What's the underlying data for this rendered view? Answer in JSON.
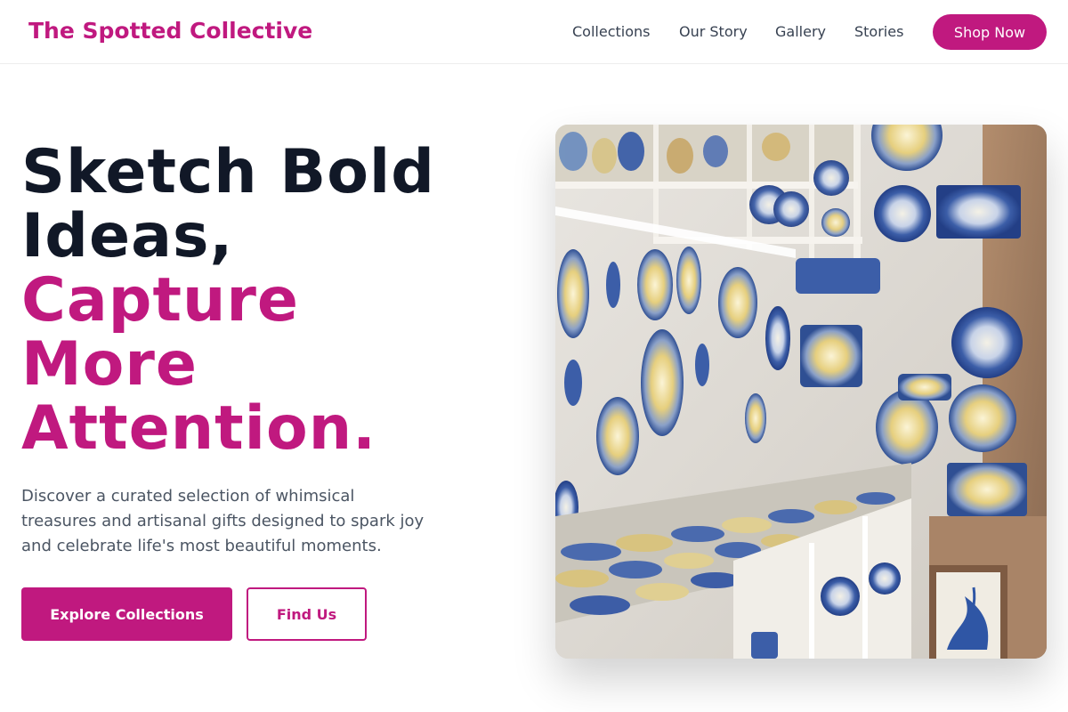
{
  "header": {
    "brand": "The Spotted Collective",
    "nav": [
      "Collections",
      "Our Story",
      "Gallery",
      "Stories"
    ],
    "cta": "Shop Now"
  },
  "hero": {
    "title_dark": [
      "Sketch Bold",
      "Ideas,"
    ],
    "title_accent": [
      "Capture",
      "More",
      "Attention."
    ],
    "description": "Discover a curated selection of whimsical treasures and artisanal gifts designed to spark joy and celebrate life's most beautiful moments.",
    "primary_button": "Explore Collections",
    "secondary_button": "Find Us",
    "image_alt": "Shop shelves and walls covered with hand-painted blue and yellow ceramic plates and pottery"
  },
  "colors": {
    "accent": "#c0197f",
    "heading": "#111827",
    "body_text": "#4b5563",
    "nav_text": "#374151"
  }
}
